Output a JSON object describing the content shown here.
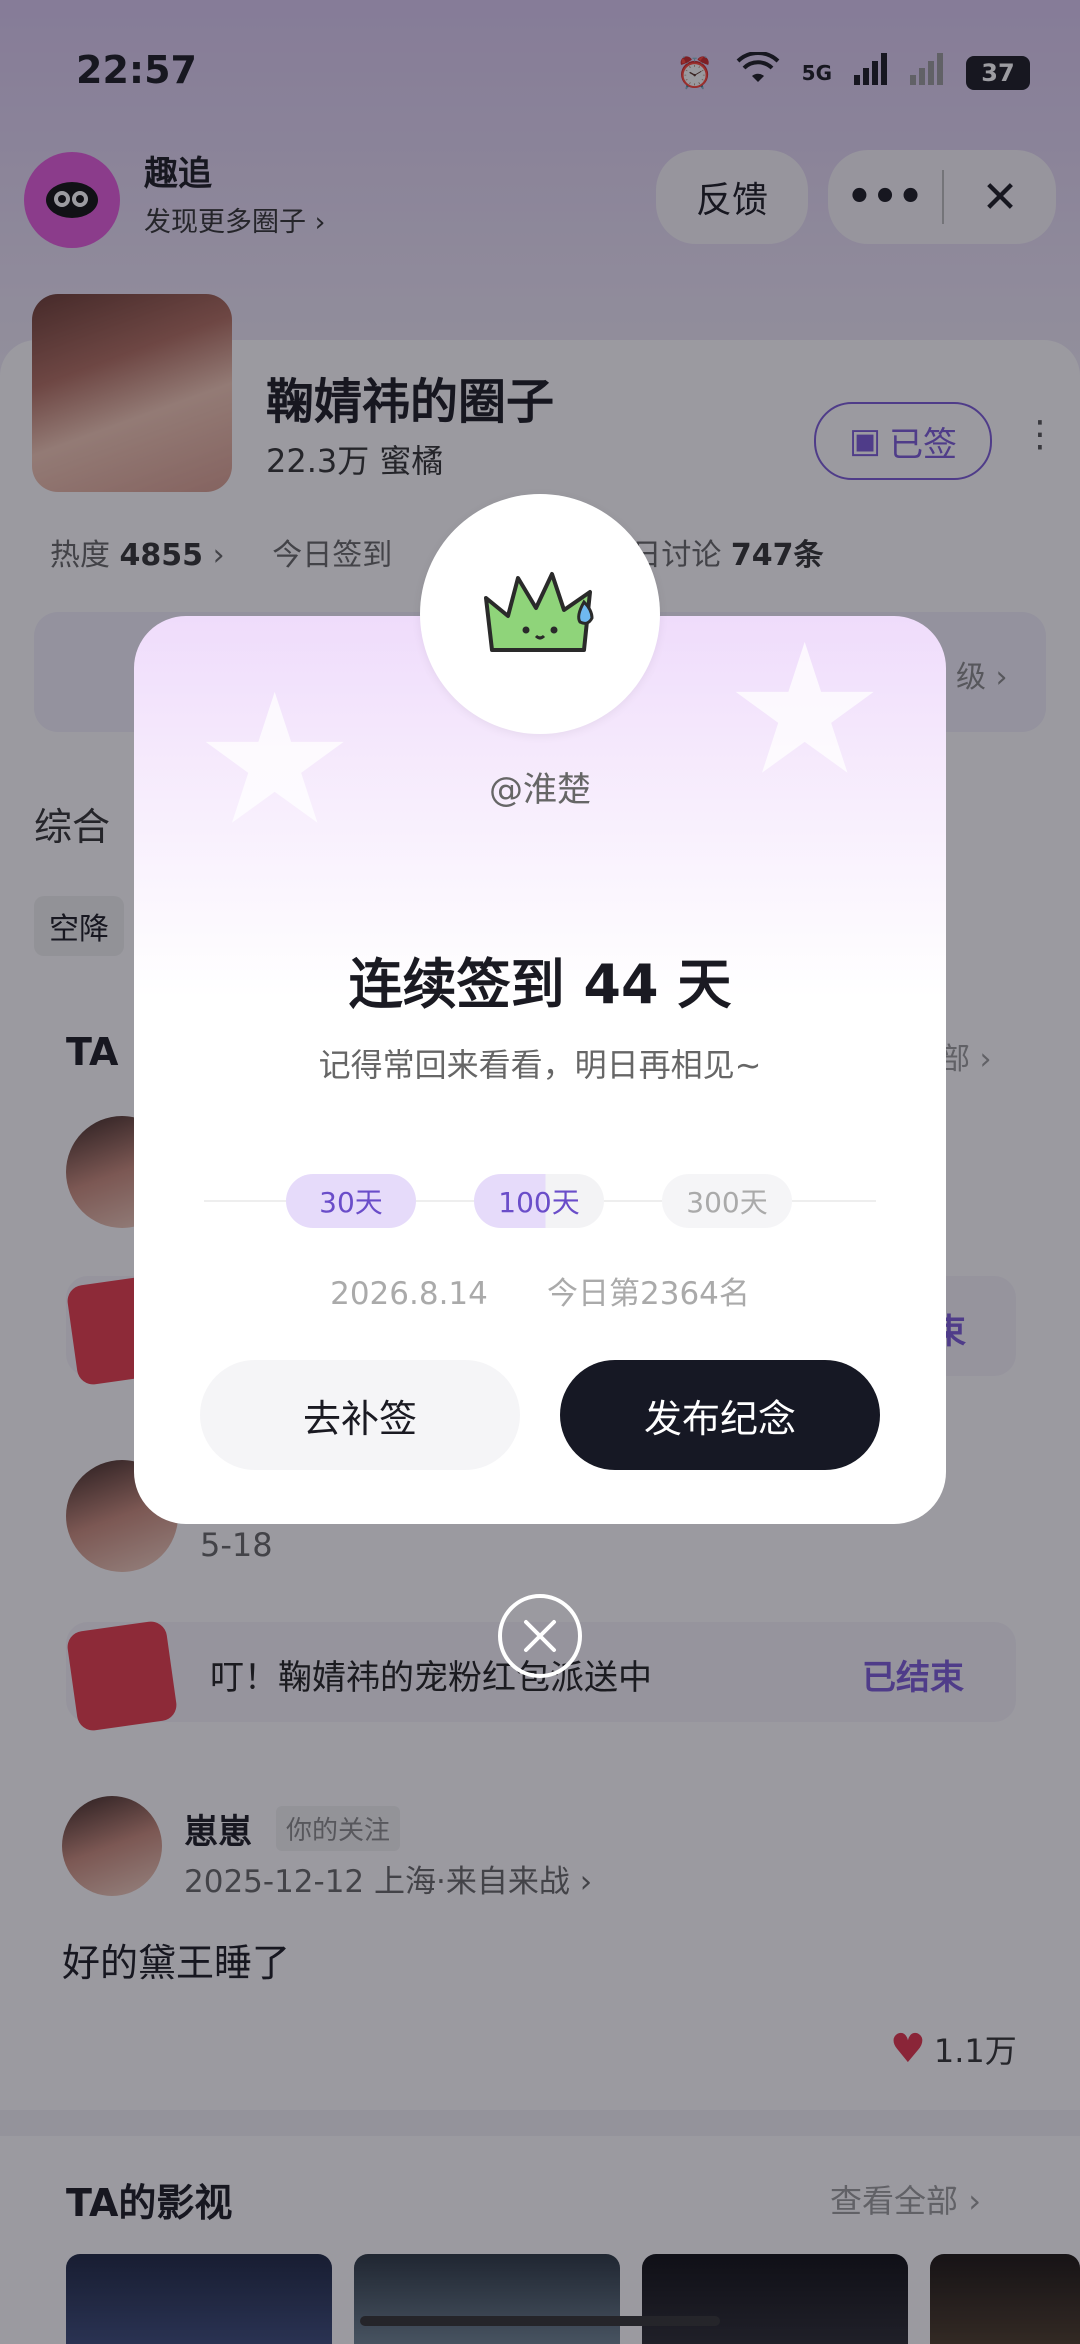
{
  "status": {
    "time": "22:57",
    "network": "5G",
    "battery": "37"
  },
  "app": {
    "name": "趣追",
    "subtitle": "发现更多圈子 ›",
    "feedback": "反馈"
  },
  "circle": {
    "title": "鞠婧祎的圈子",
    "fans": "22.3万 蜜橘",
    "signed_label": "已签",
    "heat_label": "热度",
    "heat_value": "4855",
    "today_sign_label": "今日签到",
    "today_discuss_label": "今日讨论",
    "today_discuss_value": "747条",
    "level_right": "级"
  },
  "tabs": {
    "general": "综合",
    "chip": "空降"
  },
  "section_ta": {
    "title": "TA",
    "more": "部"
  },
  "posts": [
    {
      "date": "5-18"
    }
  ],
  "redpacket": {
    "text": "叮！鞠婧祎的宠粉红包派送中",
    "status": "已结束",
    "status_partial": "束"
  },
  "post": {
    "author": "崽崽",
    "tag": "你的关注",
    "meta": "2025-12-12 上海·来自来战 ›",
    "text": "好的黛王睡了",
    "likes": "1.1万"
  },
  "section_film": {
    "title": "TA的影视",
    "more": "查看全部"
  },
  "dialog": {
    "username": "@淮楚",
    "title": "连续签到 44 天",
    "subtitle": "记得常回来看看，明日再相见~",
    "milestones": [
      "30天",
      "100天",
      "300天"
    ],
    "date": "2026.8.14",
    "rank": "今日第2364名",
    "makeup_button": "去补签",
    "publish_button": "发布纪念"
  },
  "colors": {
    "accent": "#7b5bd6",
    "dark": "#161824",
    "heart": "#e0334a"
  }
}
